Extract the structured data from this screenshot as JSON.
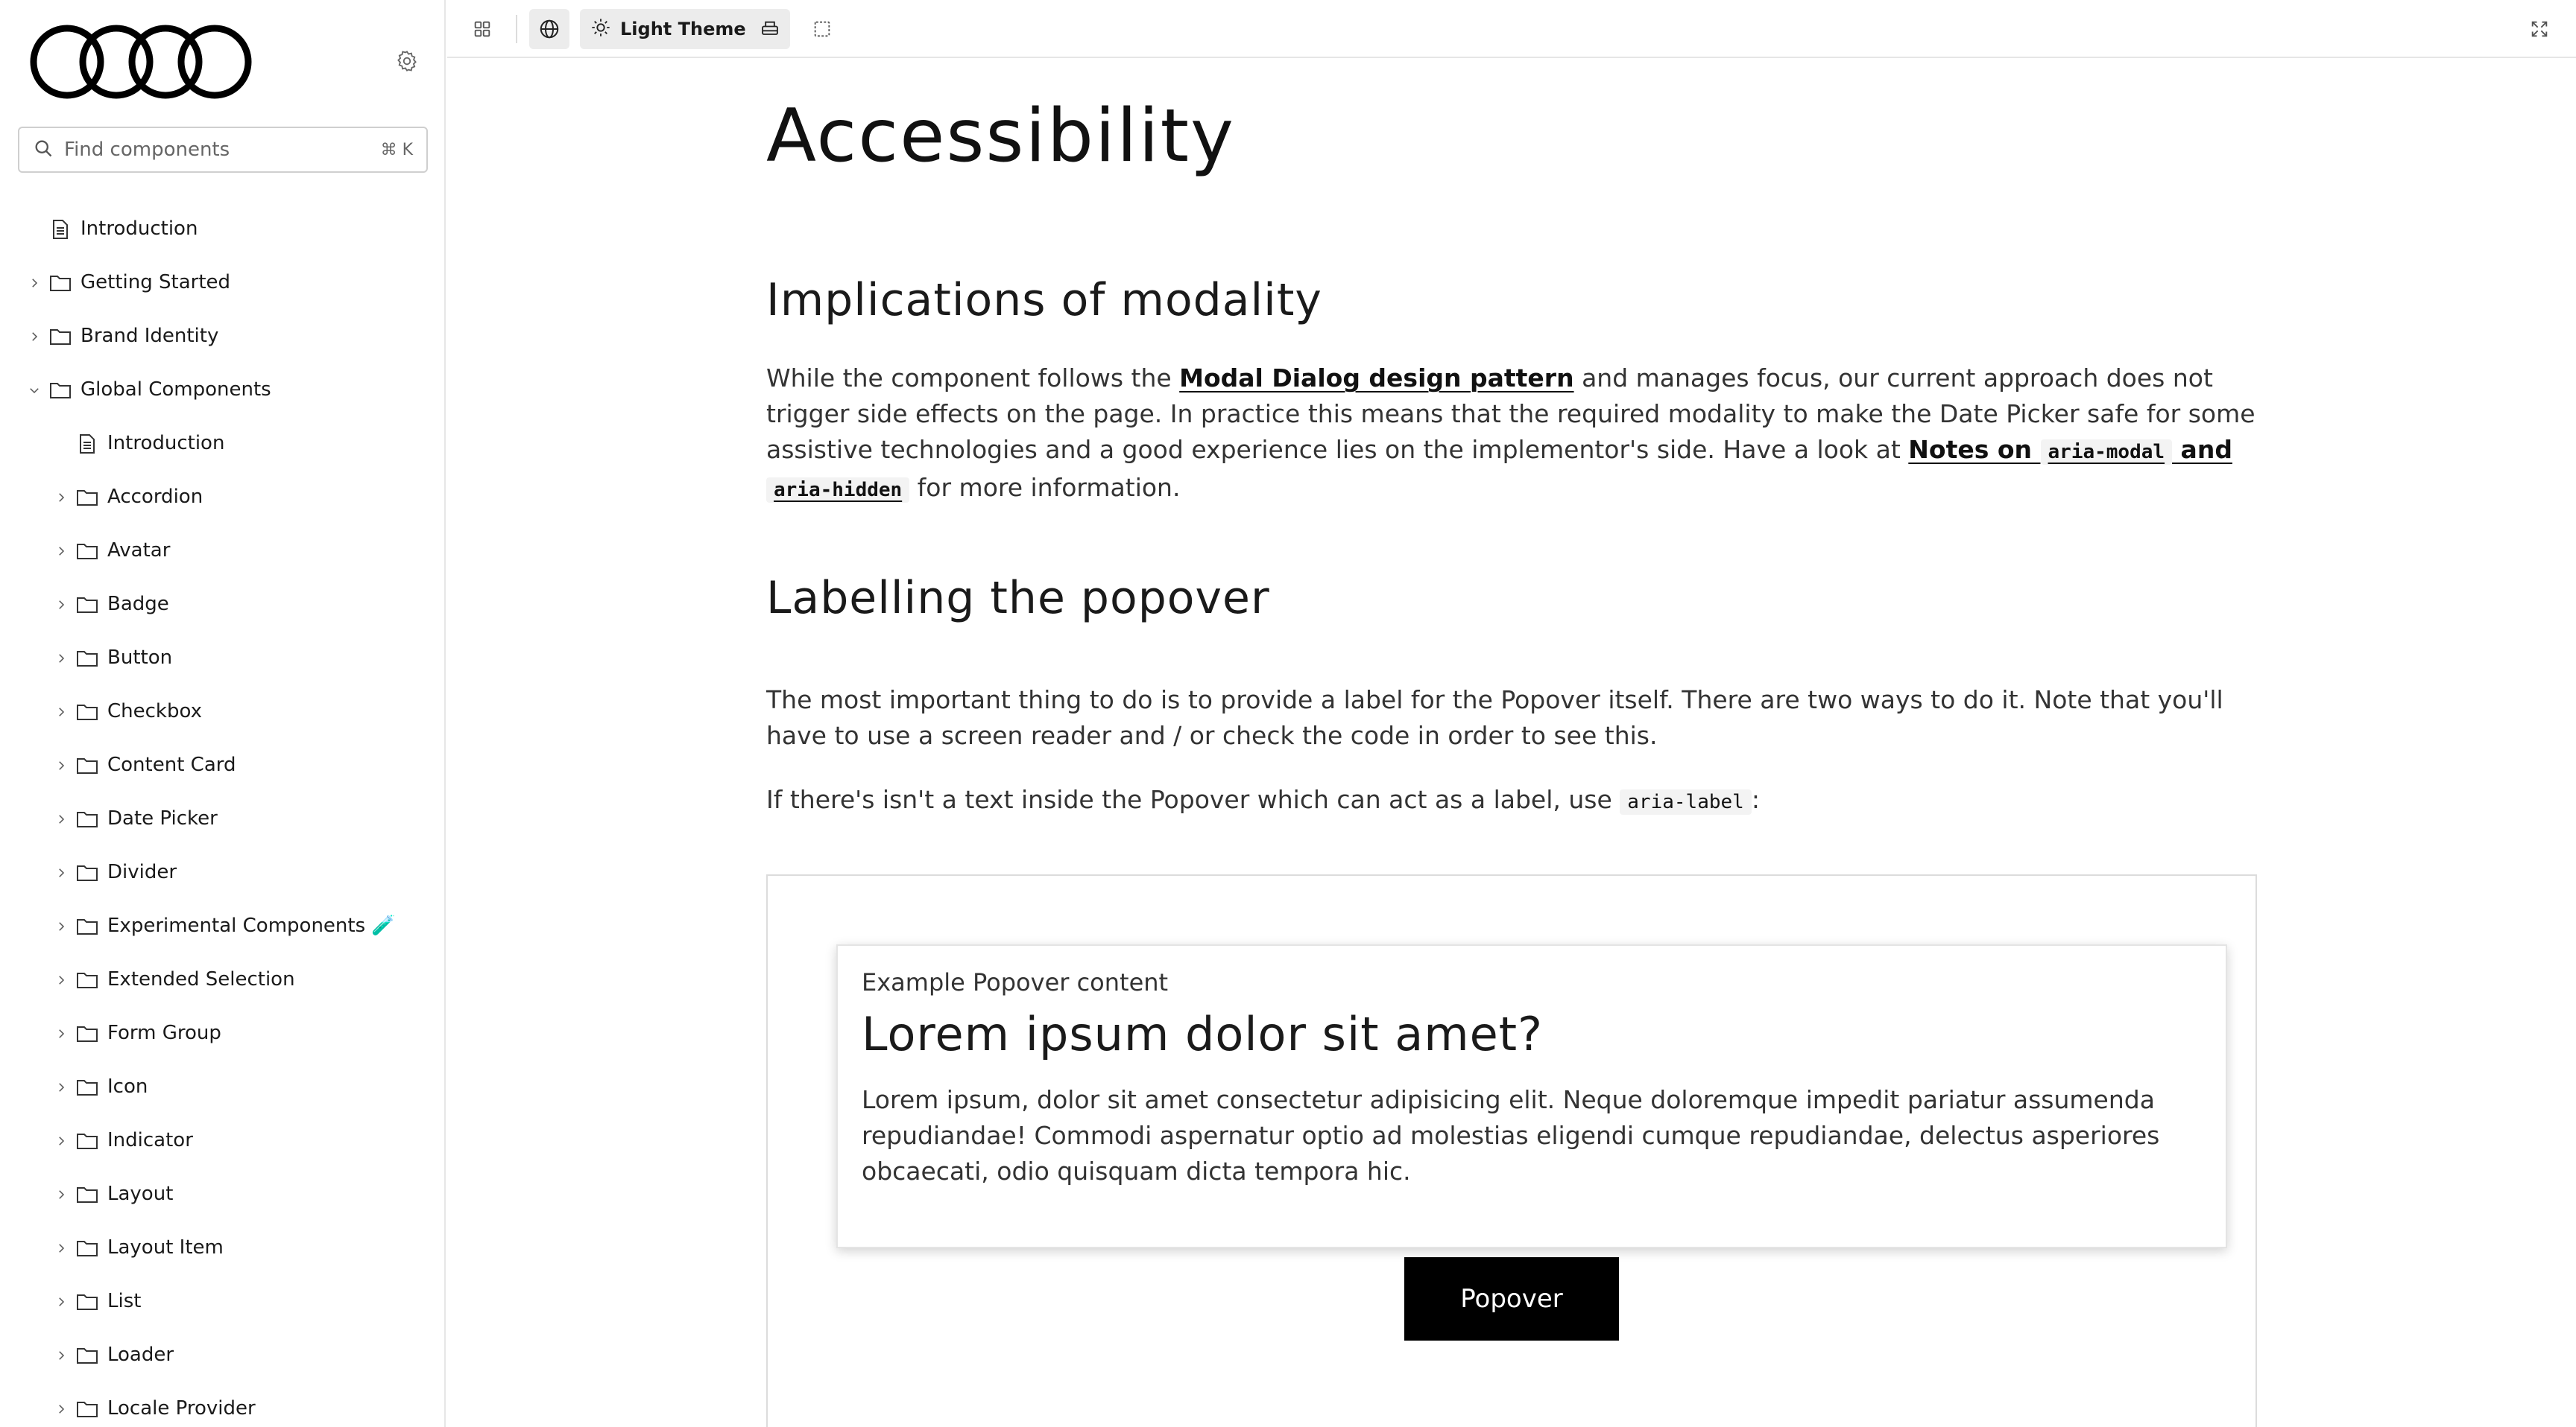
{
  "brand": {
    "logo_name": "four-rings-logo"
  },
  "search": {
    "placeholder": "Find components",
    "shortcut": "⌘ K"
  },
  "sidebar": {
    "items": [
      {
        "label": "Introduction",
        "type": "doc",
        "level": 0
      },
      {
        "label": "Getting Started",
        "type": "folder",
        "level": 0,
        "expanded": false
      },
      {
        "label": "Brand Identity",
        "type": "folder",
        "level": 0,
        "expanded": false
      },
      {
        "label": "Global Components",
        "type": "folder",
        "level": 0,
        "expanded": true
      },
      {
        "label": "Introduction",
        "type": "doc",
        "level": 1
      },
      {
        "label": "Accordion",
        "type": "folder",
        "level": 1,
        "expanded": false
      },
      {
        "label": "Avatar",
        "type": "folder",
        "level": 1,
        "expanded": false
      },
      {
        "label": "Badge",
        "type": "folder",
        "level": 1,
        "expanded": false
      },
      {
        "label": "Button",
        "type": "folder",
        "level": 1,
        "expanded": false
      },
      {
        "label": "Checkbox",
        "type": "folder",
        "level": 1,
        "expanded": false
      },
      {
        "label": "Content Card",
        "type": "folder",
        "level": 1,
        "expanded": false
      },
      {
        "label": "Date Picker",
        "type": "folder",
        "level": 1,
        "expanded": false
      },
      {
        "label": "Divider",
        "type": "folder",
        "level": 1,
        "expanded": false
      },
      {
        "label": "Experimental Components 🧪",
        "type": "folder",
        "level": 1,
        "expanded": false
      },
      {
        "label": "Extended Selection",
        "type": "folder",
        "level": 1,
        "expanded": false
      },
      {
        "label": "Form Group",
        "type": "folder",
        "level": 1,
        "expanded": false
      },
      {
        "label": "Icon",
        "type": "folder",
        "level": 1,
        "expanded": false
      },
      {
        "label": "Indicator",
        "type": "folder",
        "level": 1,
        "expanded": false
      },
      {
        "label": "Layout",
        "type": "folder",
        "level": 1,
        "expanded": false
      },
      {
        "label": "Layout Item",
        "type": "folder",
        "level": 1,
        "expanded": false
      },
      {
        "label": "List",
        "type": "folder",
        "level": 1,
        "expanded": false
      },
      {
        "label": "Loader",
        "type": "folder",
        "level": 1,
        "expanded": false
      },
      {
        "label": "Locale Provider",
        "type": "folder",
        "level": 1,
        "expanded": false
      }
    ]
  },
  "toolbar": {
    "theme_label": "Light Theme",
    "icons": [
      "grid-icon",
      "globe-icon",
      "sun-icon",
      "printer-icon",
      "frame-icon",
      "fullscreen-icon"
    ]
  },
  "content": {
    "title": "Accessibility",
    "section1": {
      "heading": "Implications of modality",
      "p1_a": "While the component follows the ",
      "p1_link": "Modal Dialog design pattern",
      "p1_b": " and manages focus, our current approach does not trigger side effects on the page. In practice this means that the required modality to make the Date Picker safe for some assistive technologies and a good experience lies on the implementor's side. Have a look at ",
      "p1_link2_a": "Notes on ",
      "p1_code1": "aria-modal",
      "p1_link2_b": " and ",
      "p1_code2": "aria-hidden",
      "p1_c": " for more information."
    },
    "section2": {
      "heading": "Labelling the popover",
      "p1": "The most important thing to do is to provide a label for the Popover itself. There are two ways to do it. Note that you'll have to use a screen reader and / or check the code in order to see this.",
      "p2_a": "If there's isn't a text inside the Popover which can act as a label, use ",
      "p2_code": "aria-label",
      "p2_b": ":"
    },
    "example": {
      "caption": "Example Popover content",
      "heading": "Lorem ipsum dolor sit amet?",
      "text": "Lorem ipsum, dolor sit amet consectetur adipisicing elit. Neque doloremque impedit pariatur assumenda repudiandae! Commodi aspernatur optio ad molestias eligendi cumque repudiandae, delectus asperiores obcaecati, odio quisquam dicta tempora hic.",
      "button_label": "Popover"
    }
  }
}
